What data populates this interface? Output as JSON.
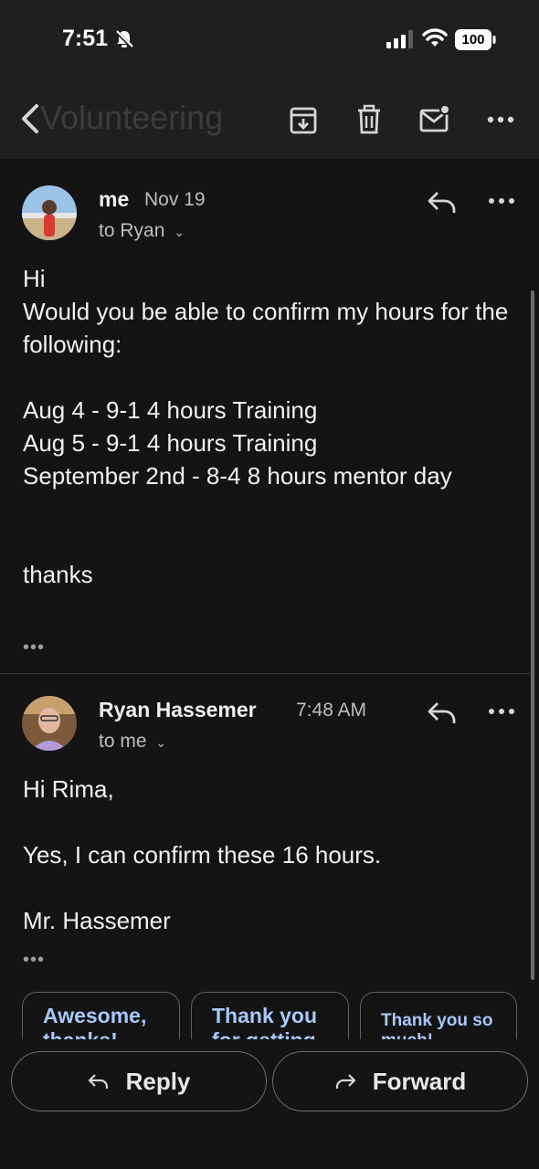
{
  "status_bar": {
    "time": "7:51",
    "battery": "100"
  },
  "toolbar": {
    "faded_title": "Volunteering",
    "icons": [
      "back-arrow-icon",
      "archive-icon",
      "trash-icon",
      "mark-unread-icon",
      "more-icon"
    ]
  },
  "messages": [
    {
      "sender": "me",
      "date": "Nov 19",
      "to": "to Ryan",
      "body": "Hi\nWould you be able to confirm my hours for the following:\n\nAug 4 - 9-1 4 hours Training\nAug 5 - 9-1 4 hours Training\nSeptember 2nd - 8-4 8 hours mentor day\n\n\nthanks",
      "ellipsis": "•••"
    },
    {
      "sender": "Ryan Hassemer",
      "date": "7:48 AM",
      "to": "to me",
      "body": "Hi Rima,\n\nYes, I can confirm these 16 hours.\n\nMr. Hassemer",
      "ellipsis": "•••"
    }
  ],
  "smart_replies": [
    {
      "line1": "Awesome,",
      "line2": "thanks!"
    },
    {
      "line1": "Thank you",
      "line2": "for getting"
    },
    {
      "line1": "Thank you so",
      "line2": "much!"
    }
  ],
  "actions": {
    "reply": "Reply",
    "forward": "Forward"
  },
  "colors": {
    "background": "#141414",
    "toolbar": "#1f1f1f",
    "chip_text": "#a8c7fa"
  }
}
